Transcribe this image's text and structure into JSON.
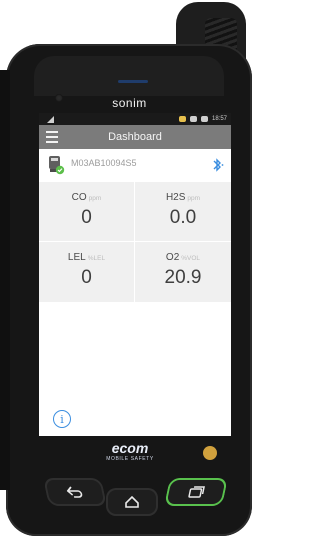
{
  "brand": "sonim",
  "status": {
    "time": "18:57"
  },
  "appbar": {
    "title": "Dashboard"
  },
  "device": {
    "serial": "M03AB10094S5"
  },
  "readings": [
    {
      "gas": "CO",
      "unit": "ppm",
      "value": "0"
    },
    {
      "gas": "H2S",
      "unit": "ppm",
      "value": "0.0"
    },
    {
      "gas": "LEL",
      "unit": "%LEL",
      "value": "0"
    },
    {
      "gas": "O2",
      "unit": "%VOL",
      "value": "20.9"
    }
  ],
  "footer": {
    "logo_text": "ecom",
    "tagline": "MOBILE SAFETY"
  },
  "icons": {
    "menu": "menu-icon",
    "bluetooth": "bluetooth-icon",
    "info": "info-icon",
    "back": "back-icon",
    "home": "home-icon",
    "recent": "recent-apps-icon"
  },
  "colors": {
    "accent_blue": "#3b8ee0",
    "appbar_gray": "#7b7b7b",
    "ok_green": "#5cbf4a"
  }
}
